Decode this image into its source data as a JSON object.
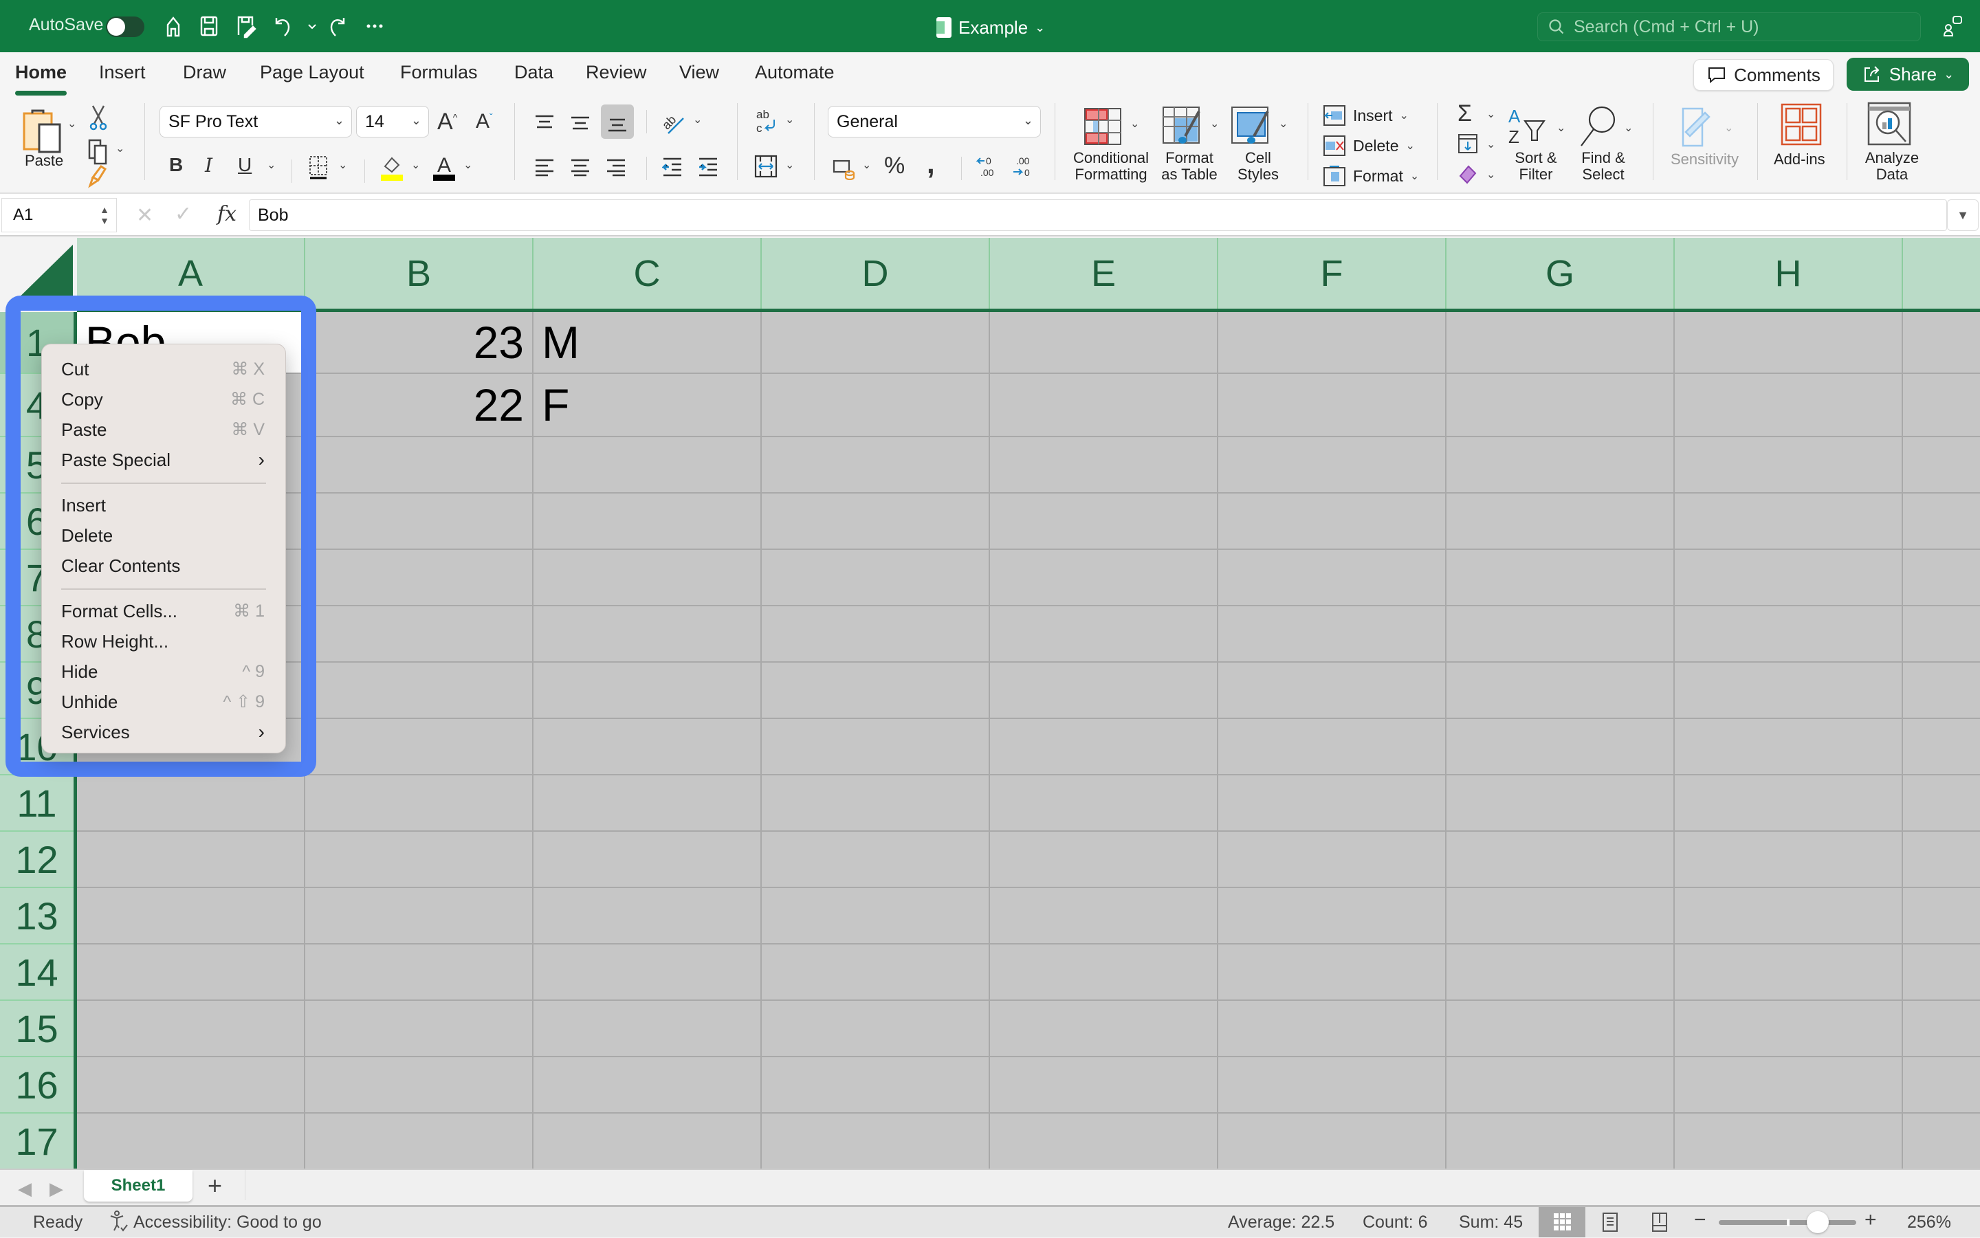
{
  "titlebar": {
    "autosave_label": "AutoSave",
    "autosave_on": false,
    "doc_title": "Example",
    "search_placeholder": "Search (Cmd + Ctrl + U)"
  },
  "tabs": [
    {
      "label": "Home",
      "active": true
    },
    {
      "label": "Insert"
    },
    {
      "label": "Draw"
    },
    {
      "label": "Page Layout"
    },
    {
      "label": "Formulas"
    },
    {
      "label": "Data"
    },
    {
      "label": "Review"
    },
    {
      "label": "View"
    },
    {
      "label": "Automate"
    }
  ],
  "header_buttons": {
    "comments": "Comments",
    "share": "Share"
  },
  "ribbon": {
    "paste": "Paste",
    "font_name": "SF Pro Text",
    "font_size": "14",
    "number_format": "General",
    "conditional_formatting": [
      "Conditional",
      "Formatting"
    ],
    "format_as_table": [
      "Format",
      "as Table"
    ],
    "cell_styles": [
      "Cell",
      "Styles"
    ],
    "insert": "Insert",
    "delete": "Delete",
    "format": "Format",
    "sort_filter": [
      "Sort &",
      "Filter"
    ],
    "find_select": [
      "Find &",
      "Select"
    ],
    "sensitivity": "Sensitivity",
    "add_ins": "Add-ins",
    "analyze_data": [
      "Analyze",
      "Data"
    ],
    "highlight_color": "#ffff00",
    "font_color": "#000000"
  },
  "formula_bar": {
    "name_box": "A1",
    "fx": "fx",
    "value": "Bob"
  },
  "columns": [
    "A",
    "B",
    "C",
    "D",
    "E",
    "F",
    "G",
    "H"
  ],
  "rows": [
    "1",
    "4",
    "5",
    "6",
    "7",
    "8",
    "9",
    "10",
    "11",
    "12",
    "13",
    "14",
    "15",
    "16",
    "17"
  ],
  "cells": {
    "A1": "Bob",
    "B1": "23",
    "C1": "M",
    "B4": "22",
    "C4": "F"
  },
  "context_menu": {
    "groups": [
      [
        {
          "label": "Cut",
          "shortcut": "⌘ X"
        },
        {
          "label": "Copy",
          "shortcut": "⌘ C"
        },
        {
          "label": "Paste",
          "shortcut": "⌘ V"
        },
        {
          "label": "Paste Special",
          "submenu": true
        }
      ],
      [
        {
          "label": "Insert"
        },
        {
          "label": "Delete"
        },
        {
          "label": "Clear Contents"
        }
      ],
      [
        {
          "label": "Format Cells...",
          "shortcut": "⌘ 1"
        },
        {
          "label": "Row Height..."
        },
        {
          "label": "Hide",
          "shortcut": "^ 9"
        },
        {
          "label": "Unhide",
          "shortcut": "^ ⇧ 9"
        },
        {
          "label": "Services",
          "submenu": true
        }
      ]
    ]
  },
  "sheets": [
    {
      "label": "Sheet1",
      "active": true
    }
  ],
  "status": {
    "ready": "Ready",
    "accessibility": "Accessibility: Good to go",
    "average": "Average: 22.5",
    "count": "Count: 6",
    "sum": "Sum: 45",
    "zoom": "256%",
    "zoom_level_fraction": 0.72
  },
  "colors": {
    "brand_green": "#107c41",
    "highlight_outline": "#4f7ff5",
    "header_green": "#badbc7"
  }
}
